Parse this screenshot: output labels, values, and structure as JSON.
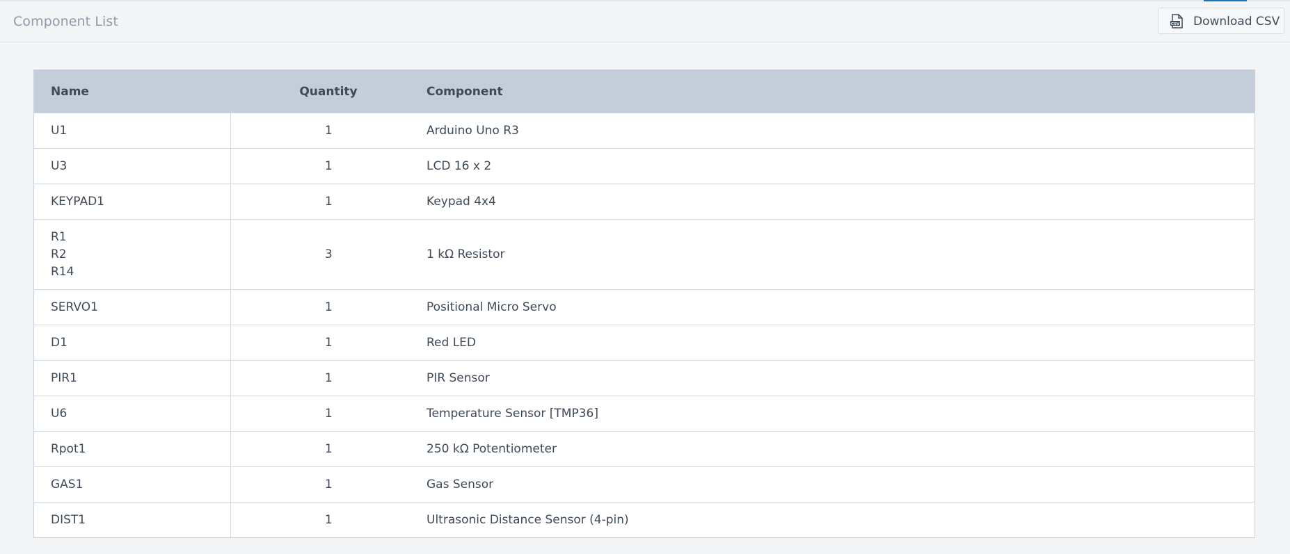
{
  "header": {
    "title": "Component List",
    "download_label": "Download CSV",
    "download_icon": "csv-file-icon"
  },
  "table": {
    "columns": [
      "Name",
      "Quantity",
      "Component"
    ],
    "rows": [
      {
        "names": [
          "U1"
        ],
        "quantity": "1",
        "component": "Arduino Uno R3"
      },
      {
        "names": [
          "U3"
        ],
        "quantity": "1",
        "component": "LCD 16 x 2"
      },
      {
        "names": [
          "KEYPAD1"
        ],
        "quantity": "1",
        "component": "Keypad 4x4"
      },
      {
        "names": [
          "R1",
          "R2",
          "R14"
        ],
        "quantity": "3",
        "component": "1 kΩ Resistor"
      },
      {
        "names": [
          "SERVO1"
        ],
        "quantity": "1",
        "component": "Positional Micro Servo"
      },
      {
        "names": [
          "D1"
        ],
        "quantity": "1",
        "component": "Red LED"
      },
      {
        "names": [
          "PIR1"
        ],
        "quantity": "1",
        "component": "PIR Sensor"
      },
      {
        "names": [
          "U6"
        ],
        "quantity": "1",
        "component": "Temperature Sensor [TMP36]"
      },
      {
        "names": [
          "Rpot1"
        ],
        "quantity": "1",
        "component": "250 kΩ Potentiometer"
      },
      {
        "names": [
          "GAS1"
        ],
        "quantity": "1",
        "component": "Gas Sensor"
      },
      {
        "names": [
          "DIST1"
        ],
        "quantity": "1",
        "component": "Ultrasonic Distance Sensor (4-pin)"
      }
    ]
  }
}
